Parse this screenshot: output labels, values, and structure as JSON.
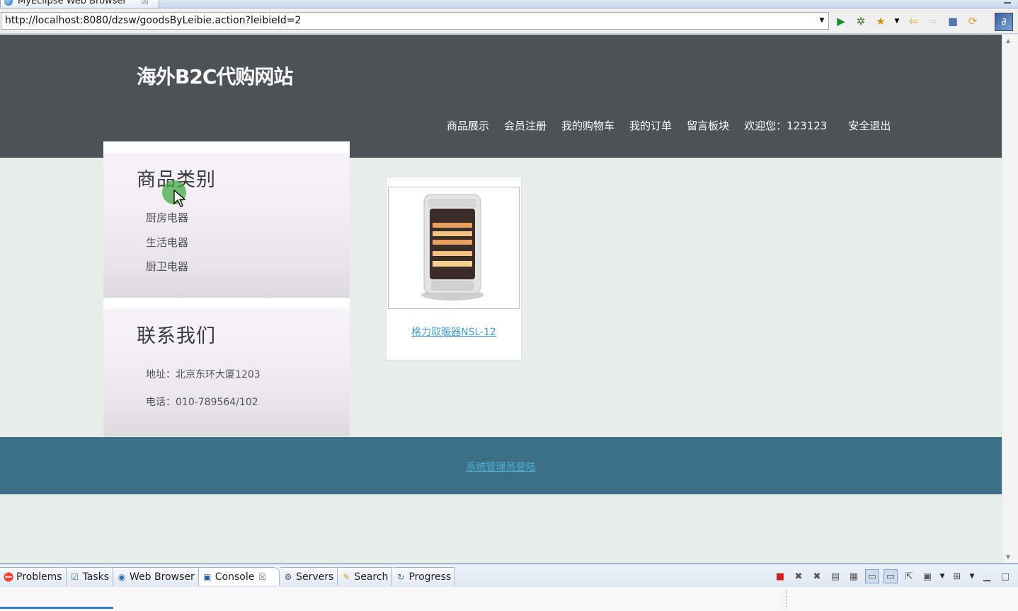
{
  "window": {
    "editor_tab_title": "MyEclipse Web Browser",
    "editor_tab_close": "☒"
  },
  "browser": {
    "url": "http://localhost:8080/dzsw/goodsByLeibie.action?leibieId=2"
  },
  "site": {
    "title": "海外B2C代购网站",
    "nav": {
      "products": "商品展示",
      "register": "会员注册",
      "cart": "我的购物车",
      "orders": "我的订单",
      "messages": "留言板块",
      "welcome": "欢迎您：123123",
      "logout": "安全退出"
    },
    "categories": {
      "heading": "商品类别",
      "items": [
        "厨房电器",
        "生活电器",
        "厨卫电器"
      ]
    },
    "contact": {
      "heading": "联系我们",
      "address": "地址：北京东环大厦1203",
      "phone": "电话：010-789564/102"
    },
    "product": {
      "name": "格力取暖器NSL-12"
    },
    "footer": {
      "admin_login": "系统管理员登陆"
    }
  },
  "bottom_panel": {
    "tabs": [
      {
        "label": "Problems",
        "icon": "problems-icon"
      },
      {
        "label": "Tasks",
        "icon": "tasks-icon"
      },
      {
        "label": "Web Browser",
        "icon": "globe-icon"
      },
      {
        "label": "Console",
        "icon": "console-icon"
      },
      {
        "label": "Servers",
        "icon": "servers-icon"
      },
      {
        "label": "Search",
        "icon": "search-icon"
      },
      {
        "label": "Progress",
        "icon": "progress-icon"
      }
    ],
    "active_tab": "Console"
  },
  "colors": {
    "header_bg": "#4c5255",
    "page_bg": "#e7ede7",
    "footer_bg": "#3c7086",
    "link": "#4a9fc9"
  }
}
